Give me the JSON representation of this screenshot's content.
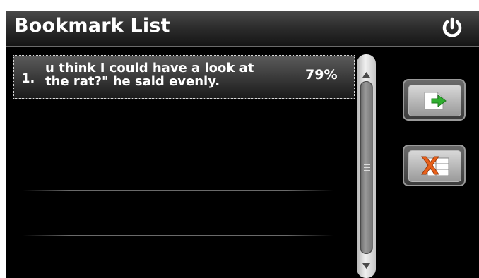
{
  "header": {
    "title": "Bookmark List",
    "power_icon": "power-icon"
  },
  "bookmarks": [
    {
      "number": "1.",
      "text": "u think I could have a look at\nthe rat?\" he said evenly.",
      "percent": "79%",
      "selected": true
    }
  ],
  "side_buttons": [
    {
      "icon": "goto-bookmark-icon"
    },
    {
      "icon": "delete-bookmark-icon"
    }
  ],
  "colors": {
    "background": "#000000",
    "header_top": "#4a4a4a",
    "text": "#ffffff",
    "arrow_green": "#2fae2f",
    "delete_orange": "#e8601a"
  }
}
